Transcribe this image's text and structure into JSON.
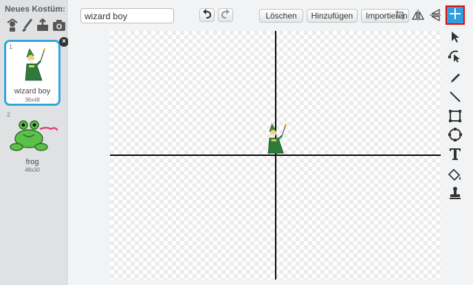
{
  "sidebar": {
    "new_costume_label": "Neues Kostüm:",
    "new_costume_icons": [
      "sprite-library-icon",
      "paint-brush-icon",
      "upload-icon",
      "camera-icon"
    ],
    "costumes": [
      {
        "number": "1",
        "name": "wizard boy",
        "size": "36x48",
        "selected": true
      },
      {
        "number": "2",
        "name": "frog",
        "size": "48x30",
        "selected": false
      }
    ]
  },
  "editor": {
    "costume_name_value": "wizard boy",
    "buttons": {
      "clear": "Löschen",
      "add": "Hinzufügen",
      "import": "Importieren"
    },
    "accent_color": "#2f9ee0",
    "selected_tile_color": "#30a6e0",
    "right_tools": [
      "select-icon",
      "reshape-icon",
      "pencil-icon",
      "line-icon",
      "rectangle-icon",
      "ellipse-icon",
      "text-icon",
      "fill-icon",
      "stamp-icon"
    ]
  }
}
